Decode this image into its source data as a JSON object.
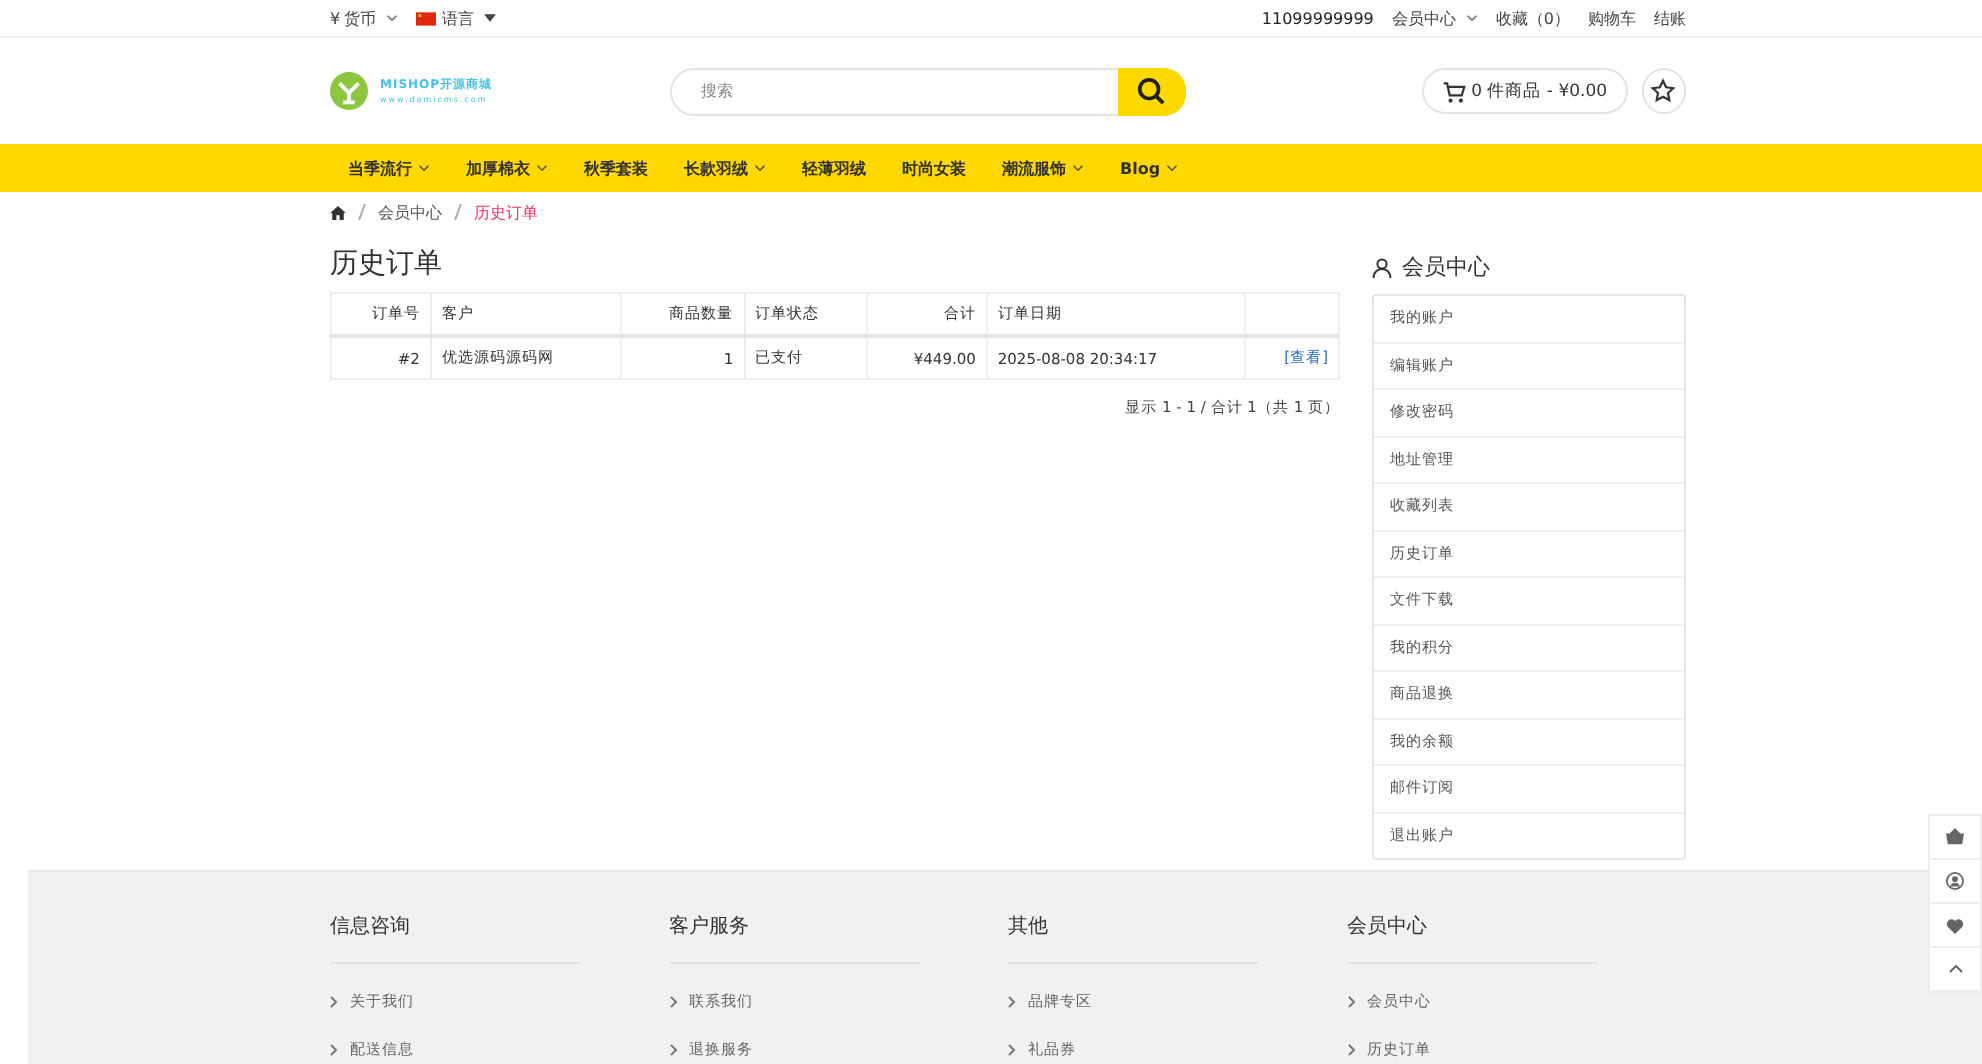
{
  "top_bar": {
    "currency_symbol": "¥",
    "currency": "货币",
    "language": "语言",
    "phone": "11099999999",
    "account": "会员中心",
    "wishlist": "收藏（0）",
    "cart": "购物车",
    "checkout": "结账"
  },
  "header": {
    "logo_title": "MISHOP开源商城",
    "logo_url": "www.damicms.com",
    "search": {
      "placeholder": "搜索"
    },
    "cart_summary": "0 件商品 - ¥0.00"
  },
  "nav": [
    {
      "label": "当季流行",
      "has_menu": true
    },
    {
      "label": "加厚棉衣",
      "has_menu": true
    },
    {
      "label": "秋季套装",
      "has_menu": false
    },
    {
      "label": "长款羽绒",
      "has_menu": true
    },
    {
      "label": "轻薄羽绒",
      "has_menu": false
    },
    {
      "label": "时尚女装",
      "has_menu": false
    },
    {
      "label": "潮流服饰",
      "has_menu": true
    },
    {
      "label": "Blog",
      "has_menu": true
    }
  ],
  "breadcrumb": [
    {
      "label": "会员中心",
      "selected": false
    },
    {
      "label": "历史订单",
      "selected": true
    }
  ],
  "page_title": "历史订单",
  "table": {
    "columns": [
      {
        "label": "订单号"
      },
      {
        "label": "客户"
      },
      {
        "label": "商品数量"
      },
      {
        "label": "订单状态"
      },
      {
        "label": "合计"
      },
      {
        "label": "订单日期"
      },
      {}
    ],
    "rows": [
      {
        "order_no": "#2",
        "customer": "优选源码源码网",
        "quantity": "1",
        "status": "已支付",
        "total": "¥449.00",
        "date": "2025-08-08 20:34:17",
        "action": "[查看]"
      }
    ]
  },
  "pagination": "显示 1 - 1 / 合计 1（共 1 页）",
  "sidebar": {
    "title": "会员中心",
    "items": [
      "我的账户",
      "编辑账户",
      "修改密码",
      "地址管理",
      "收藏列表",
      "历史订单",
      "文件下载",
      "我的积分",
      "商品退换",
      "我的余额",
      "邮件订阅",
      "退出账户"
    ]
  },
  "footer": [
    {
      "title": "信息咨询",
      "links": [
        "关于我们",
        "配送信息"
      ]
    },
    {
      "title": "客户服务",
      "links": [
        "联系我们",
        "退换服务"
      ]
    },
    {
      "title": "其他",
      "links": [
        "品牌专区",
        "礼品券"
      ]
    },
    {
      "title": "会员中心",
      "links": [
        "会员中心",
        "历史订单"
      ]
    }
  ]
}
